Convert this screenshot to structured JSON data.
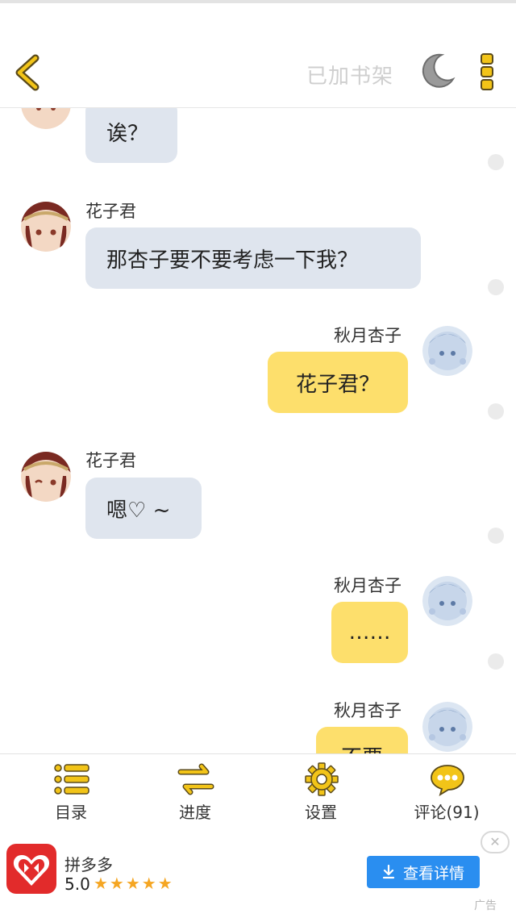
{
  "topbar": {
    "back_icon": "chevron-left-icon",
    "shelf_label": "已加书架",
    "moon_icon": "moon-icon",
    "more_icon": "more-vertical-icon"
  },
  "chat": {
    "messages": [
      {
        "side": "left",
        "name": "",
        "text": "诶？"
      },
      {
        "side": "left",
        "name": "花子君",
        "text": "那杏子要不要考虑一下我？"
      },
      {
        "side": "right",
        "name": "秋月杏子",
        "text": "花子君？"
      },
      {
        "side": "left",
        "name": "花子君",
        "text": "嗯♡ ~"
      },
      {
        "side": "right",
        "name": "秋月杏子",
        "text": "……"
      },
      {
        "side": "right",
        "name": "秋月杏子",
        "text": "不要"
      }
    ]
  },
  "bottomnav": {
    "items": [
      {
        "label": "目录",
        "icon": "list-icon"
      },
      {
        "label": "进度",
        "icon": "swap-arrows-icon"
      },
      {
        "label": "设置",
        "icon": "gear-icon"
      },
      {
        "label": "评论(91)",
        "icon": "comment-bubble-icon"
      }
    ]
  },
  "ad": {
    "app_name": "拼多多",
    "rating": "5.0",
    "stars": "★★★★★",
    "button_label": "查看详情",
    "close_label": "✕",
    "tag": "广告"
  },
  "colors": {
    "accent_yellow": "#fddf6c",
    "left_bubble": "#dfe5ee",
    "icon_yellow": "#f2c418",
    "ad_button": "#2a8ef0"
  }
}
